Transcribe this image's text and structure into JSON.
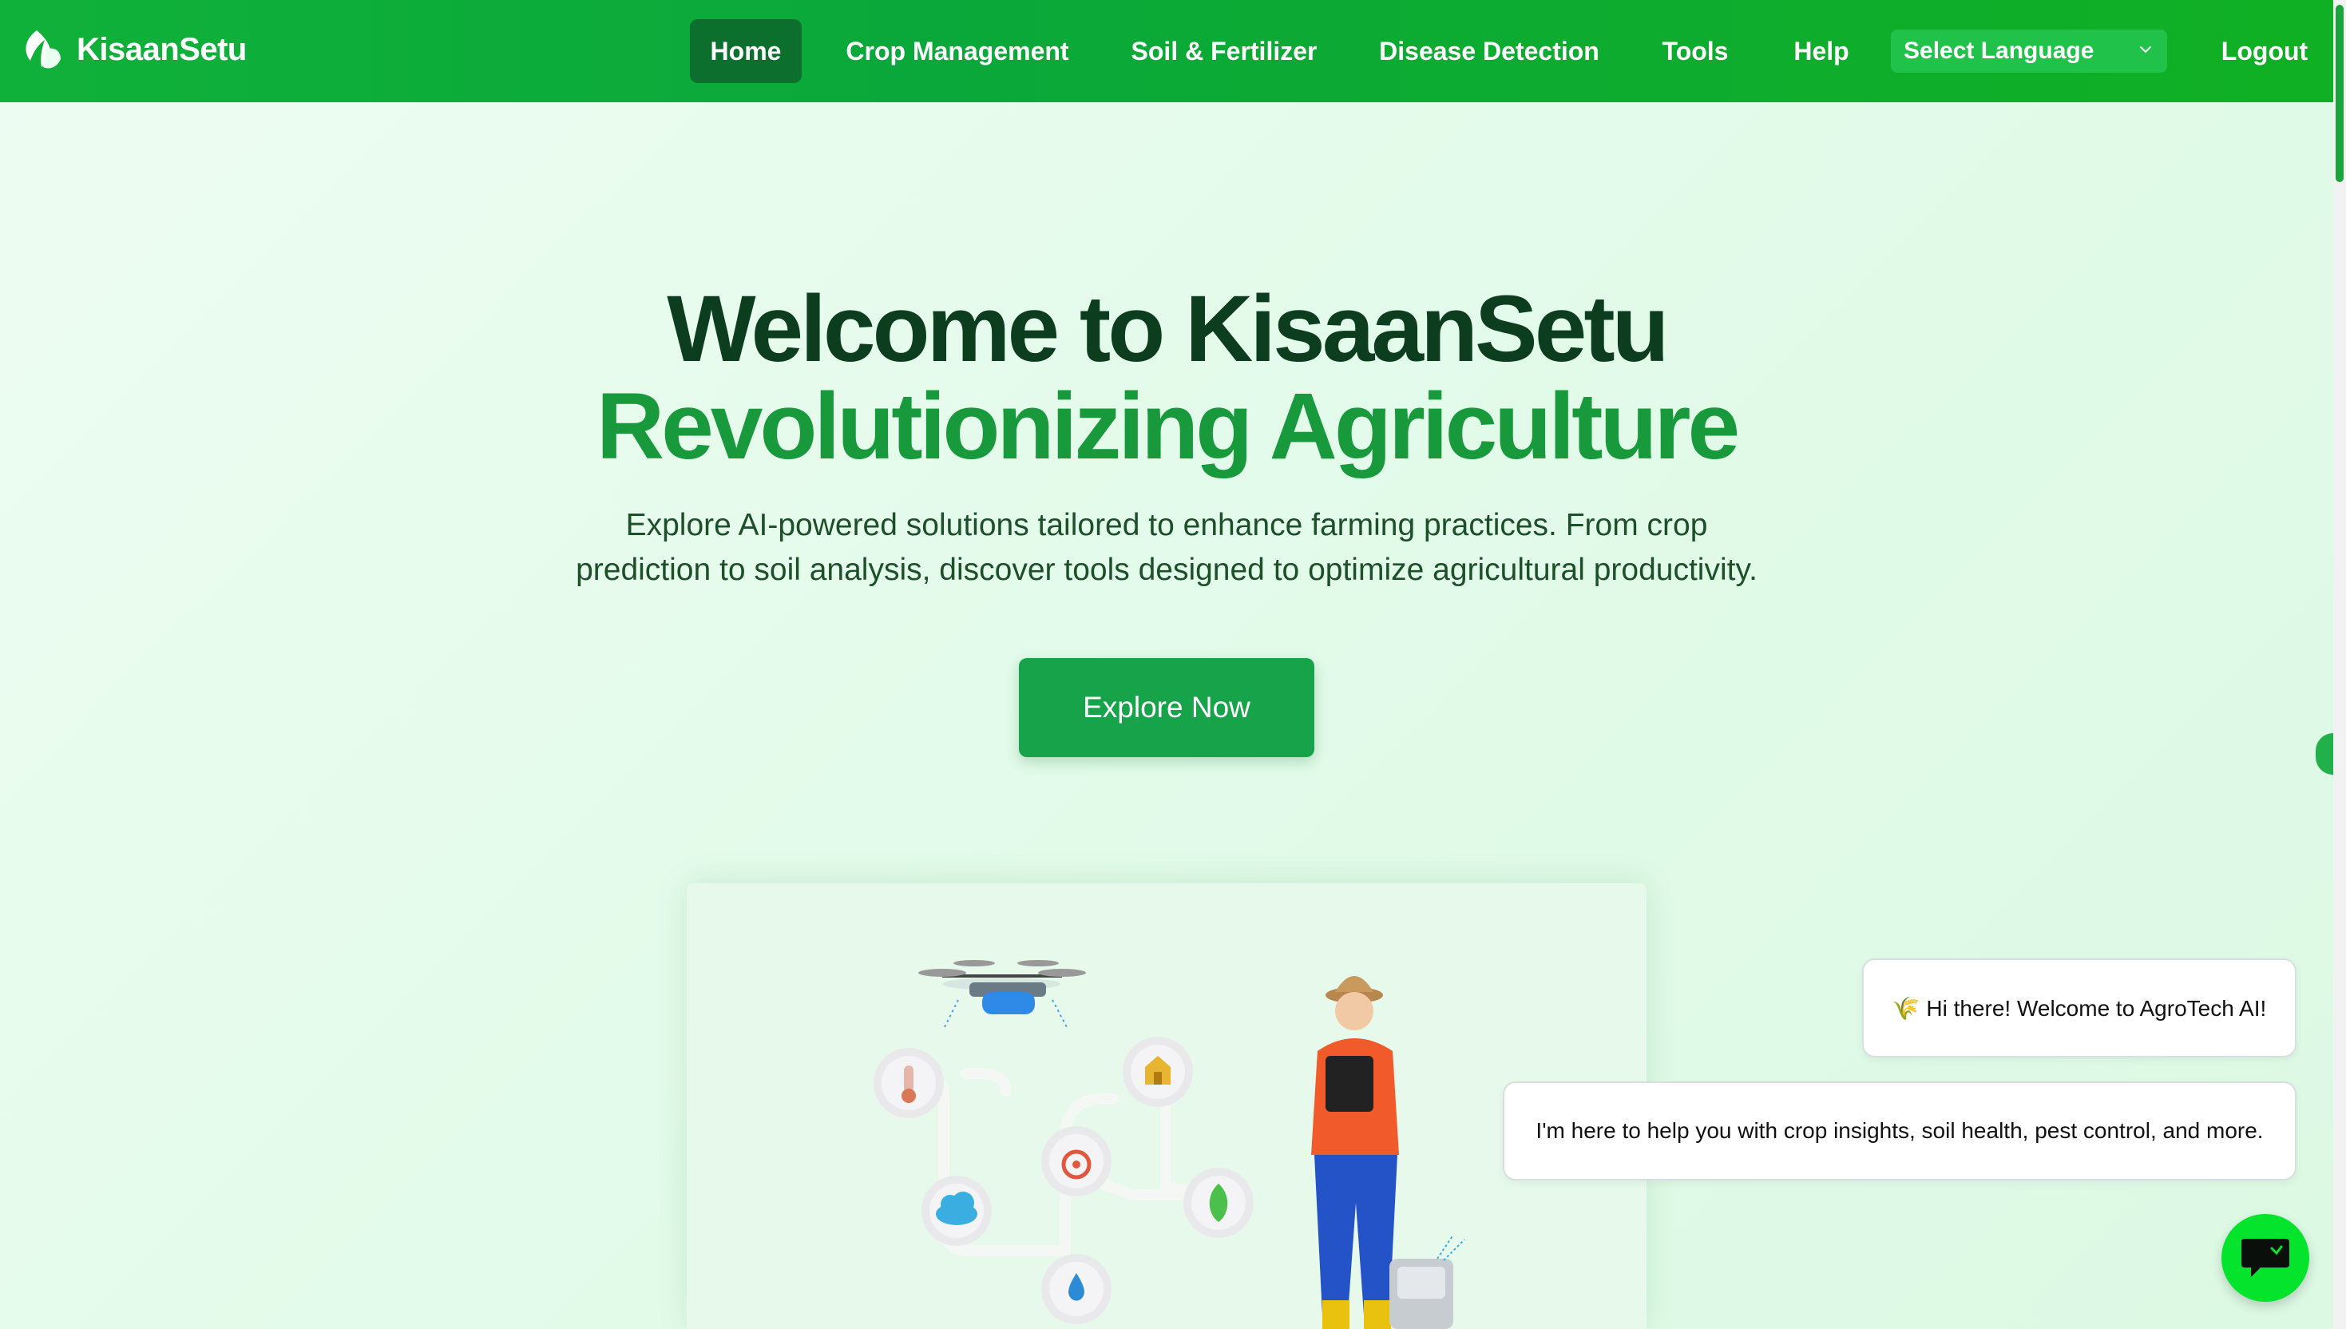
{
  "brand": {
    "name": "KisaanSetu",
    "icon": "leaf-logo-icon"
  },
  "nav": {
    "items": [
      {
        "label": "Home",
        "active": true
      },
      {
        "label": "Crop Management"
      },
      {
        "label": "Soil & Fertilizer"
      },
      {
        "label": "Disease Detection"
      },
      {
        "label": "Tools"
      },
      {
        "label": "Help"
      }
    ],
    "language_select": {
      "selected": "Select Language",
      "icon": "chevron-down-icon"
    },
    "logout_label": "Logout"
  },
  "hero": {
    "title_line1": "Welcome to KisaanSetu",
    "title_line2": "Revolutionizing Agriculture",
    "description_line1": "Explore AI-powered solutions tailored to enhance farming practices. From crop",
    "description_line2": "prediction to soil analysis, discover tools designed to optimize agricultural productivity.",
    "cta_label": "Explore Now"
  },
  "chat": {
    "greeting": "🌾 Hi there! Welcome to AgroTech AI!",
    "intro": "I'm here to help you with crop insights, soil health, pest control, and more.",
    "fab_icon": "chat-icon"
  },
  "colors": {
    "nav_green": "#10b13a",
    "active_nav": "#0d6f2e",
    "title_dark": "#0c3d1f",
    "title_green": "#18993c",
    "cta": "#16a34a",
    "chat_fab": "#05e42c"
  }
}
